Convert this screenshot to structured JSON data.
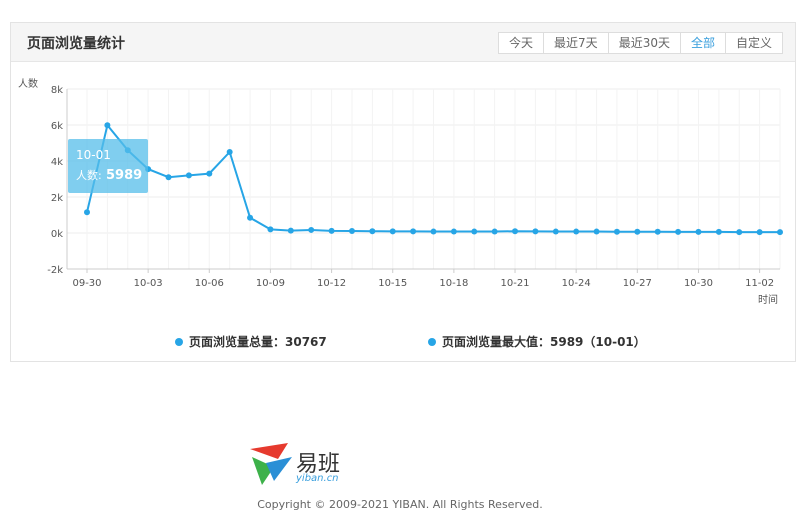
{
  "panel": {
    "title": "页面浏览量统计",
    "tabs": [
      {
        "label": "今天",
        "active": false
      },
      {
        "label": "最近7天",
        "active": false
      },
      {
        "label": "最近30天",
        "active": false
      },
      {
        "label": "全部",
        "active": true
      },
      {
        "label": "自定义",
        "active": false
      }
    ]
  },
  "chart_data": {
    "type": "line",
    "ylabel": "人数",
    "xlabel": "时间",
    "ylim": [
      -2000,
      8000
    ],
    "yticks": [
      -2000,
      0,
      2000,
      4000,
      6000,
      8000
    ],
    "ytick_labels": [
      "-2k",
      "0k",
      "2k",
      "4k",
      "6k",
      "8k"
    ],
    "x": [
      "09-30",
      "10-01",
      "10-02",
      "10-03",
      "10-04",
      "10-05",
      "10-06",
      "10-07",
      "10-08",
      "10-09",
      "10-10",
      "10-11",
      "10-12",
      "10-13",
      "10-14",
      "10-15",
      "10-16",
      "10-17",
      "10-18",
      "10-19",
      "10-20",
      "10-21",
      "10-22",
      "10-23",
      "10-24",
      "10-25",
      "10-26",
      "10-27",
      "10-28",
      "10-29",
      "10-30",
      "10-31",
      "11-01",
      "11-02",
      "11-03"
    ],
    "xtick_labels": [
      "09-30",
      "10-03",
      "10-06",
      "10-09",
      "10-12",
      "10-15",
      "10-18",
      "10-21",
      "10-24",
      "10-27",
      "10-30",
      "11-02"
    ],
    "series": [
      {
        "values": [
          1150,
          5989,
          4600,
          3550,
          3100,
          3200,
          3300,
          4500,
          850,
          200,
          130,
          170,
          120,
          110,
          100,
          90,
          90,
          80,
          80,
          80,
          80,
          100,
          90,
          80,
          80,
          80,
          70,
          70,
          70,
          60,
          60,
          60,
          50,
          50,
          50
        ],
        "color": "#27a5e6"
      }
    ],
    "grid": true,
    "tooltip": {
      "date": "10-01",
      "label": "人数:",
      "value": "5989"
    }
  },
  "summary": {
    "total_label": "页面浏览量总量：30767",
    "max_label": "页面浏览量最大值：5989（10-01）"
  },
  "footer": {
    "logo_text": "易班",
    "logo_sub": "yiban.cn",
    "copyright": "Copyright © 2009-2021 YIBAN. All Rights Reserved."
  }
}
